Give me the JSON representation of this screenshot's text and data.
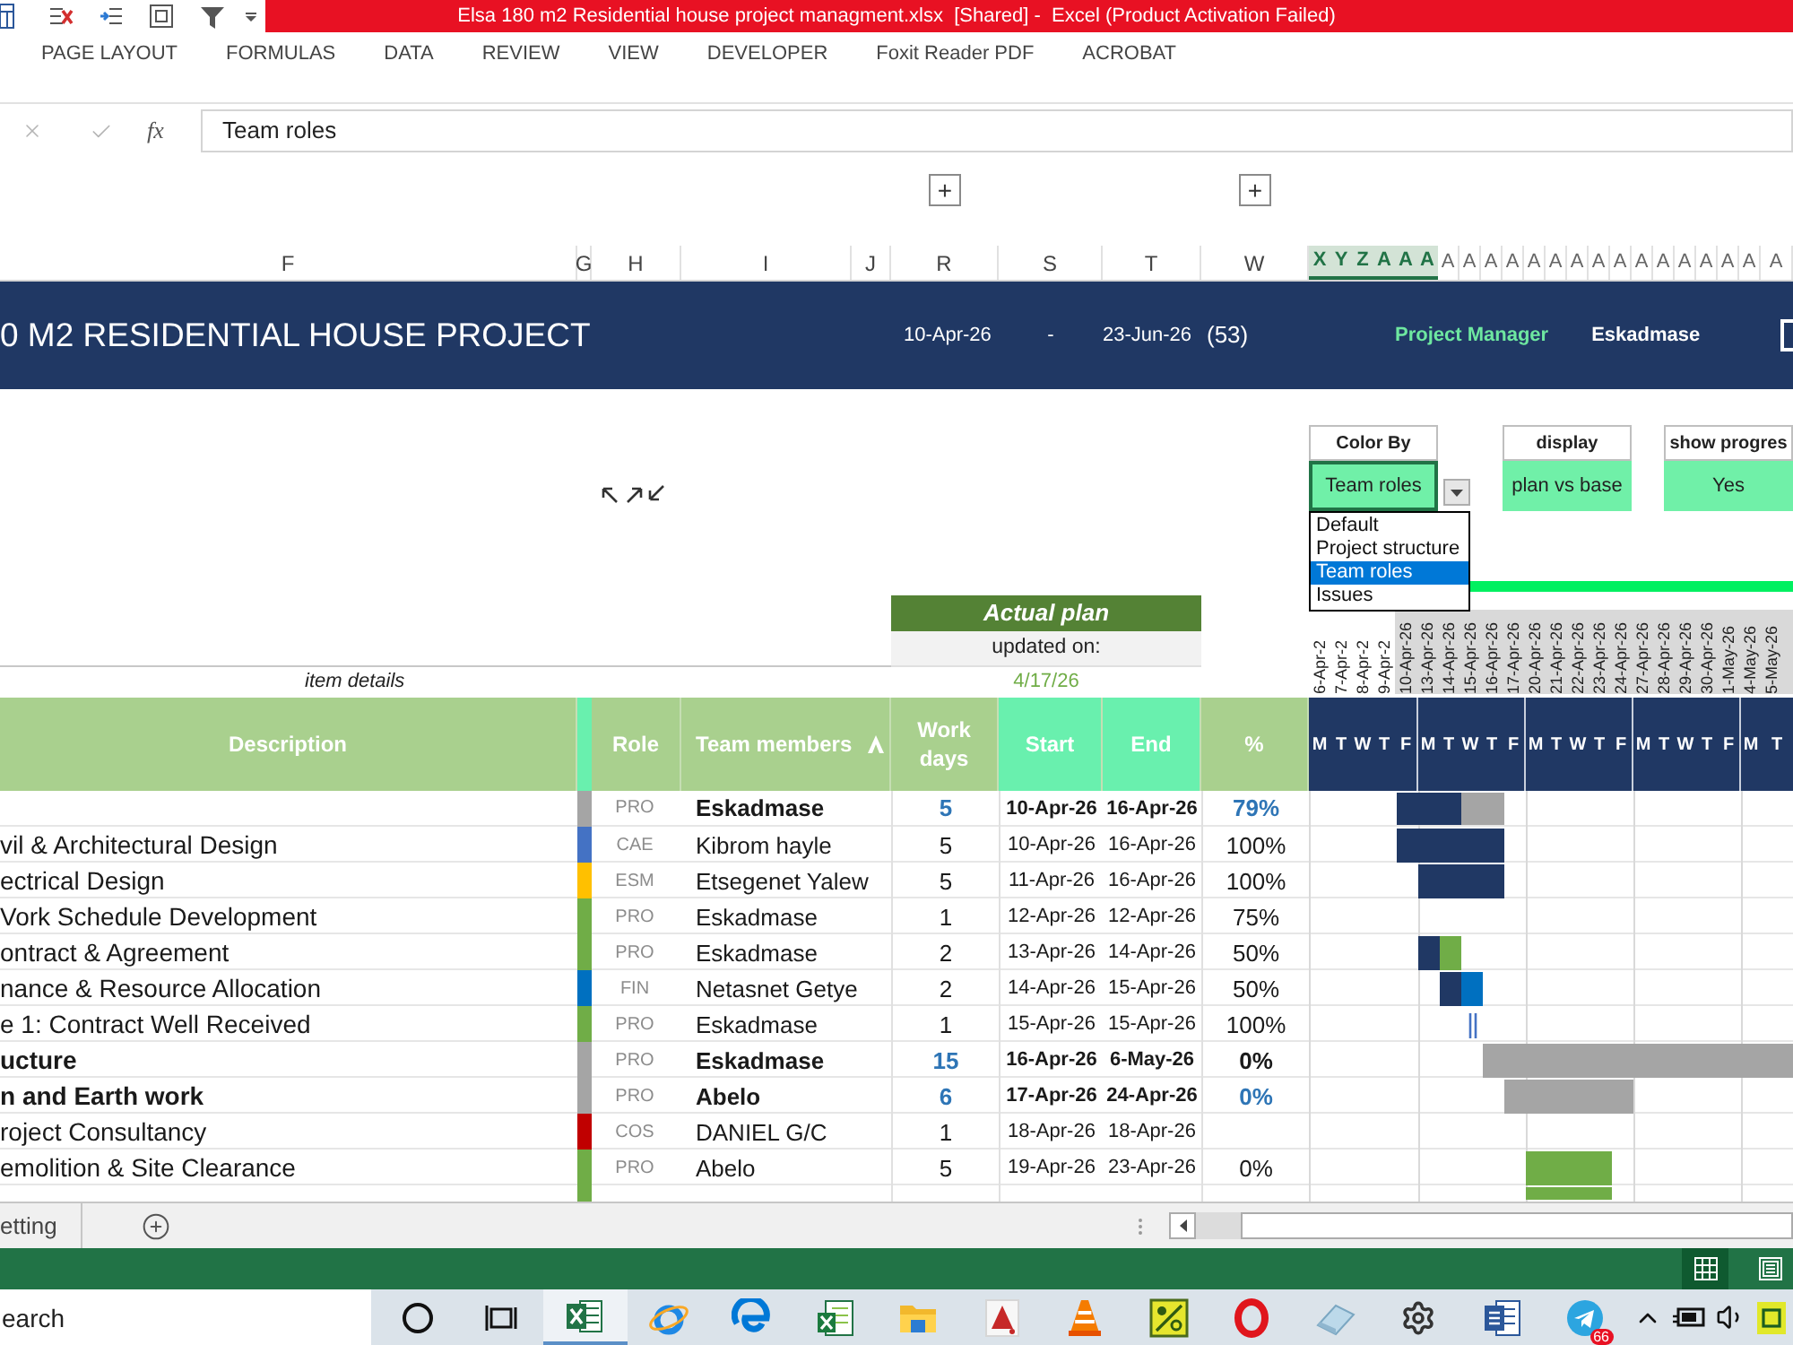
{
  "window": {
    "title": "Elsa 180 m2 Residential house project managment.xlsx  [Shared] -  Excel (Product Activation Failed)"
  },
  "ribbon_tabs": [
    "PAGE LAYOUT",
    "FORMULAS",
    "DATA",
    "REVIEW",
    "VIEW",
    "DEVELOPER",
    "Foxit Reader PDF",
    "ACROBAT"
  ],
  "formula_bar": {
    "function_label": "fx",
    "value": "Team roles"
  },
  "column_headers": [
    {
      "label": "F",
      "selected": false
    },
    {
      "label": "G",
      "selected": false
    },
    {
      "label": "H",
      "selected": false
    },
    {
      "label": "I",
      "selected": false
    },
    {
      "label": "J",
      "selected": false
    },
    {
      "label": "R",
      "selected": false,
      "outline_button": "+"
    },
    {
      "label": "S",
      "selected": false
    },
    {
      "label": "T",
      "selected": false
    },
    {
      "label": "W",
      "selected": false,
      "outline_button": "+"
    }
  ],
  "banner": {
    "title": "0 M2 RESIDENTIAL HOUSE PROJECT",
    "start": "10-Apr-26",
    "separator": "-",
    "end": "23-Jun-26",
    "duration": "(53)",
    "manager_label": "Project Manager",
    "manager": "Eskadmase"
  },
  "settings": [
    {
      "label": "Color By",
      "value": "Team roles",
      "active": true,
      "dropdown": true,
      "options": [
        {
          "label": "Default",
          "selected": false
        },
        {
          "label": "Project structure",
          "selected": false
        },
        {
          "label": "Team roles",
          "selected": true
        },
        {
          "label": "Issues",
          "selected": false
        }
      ]
    },
    {
      "label": "display",
      "value": "plan vs base",
      "active": false,
      "dropdown": false
    },
    {
      "label": "show progres",
      "value": "Yes",
      "active": false,
      "dropdown": false
    }
  ],
  "plan_header": {
    "title": "Actual plan",
    "updated_label": "updated on:",
    "updated_date": "4/17/26",
    "item_details": "item details"
  },
  "table": {
    "columns": [
      {
        "label": "Description",
        "kind": "text",
        "sorted": false
      },
      {
        "label": "Role",
        "kind": "role",
        "sorted": false
      },
      {
        "label": "Team members",
        "kind": "member",
        "sorted": true
      },
      {
        "label": "Work days",
        "kind": "number",
        "sorted": false
      },
      {
        "label": "Start",
        "kind": "date",
        "sorted": false
      },
      {
        "label": "End",
        "kind": "date",
        "sorted": false
      },
      {
        "label": "%",
        "kind": "percent",
        "sorted": false
      }
    ],
    "rows": [
      {
        "kind": "summary",
        "role": "PRO",
        "color": "#a5a5a5",
        "member": "Eskadmase",
        "work_days": "5",
        "start": "10-Apr-26",
        "end": "16-Apr-26",
        "percent": "79%",
        "percent_highlight": true,
        "timeline": [
          {
            "kind": "none"
          },
          {
            "kind": "none"
          },
          {
            "kind": "none"
          },
          {
            "kind": "none"
          },
          {
            "kind": "done"
          },
          {
            "kind": "done"
          },
          {
            "kind": "done"
          },
          {
            "kind": "todo"
          },
          {
            "kind": "todo"
          },
          {
            "kind": "none"
          },
          {
            "kind": "none"
          },
          {
            "kind": "none"
          },
          {
            "kind": "none"
          },
          {
            "kind": "none"
          },
          {
            "kind": "none"
          },
          {
            "kind": "none"
          },
          {
            "kind": "none"
          },
          {
            "kind": "none"
          },
          {
            "kind": "none"
          },
          {
            "kind": "none"
          },
          {
            "kind": "none"
          },
          {
            "kind": "none"
          }
        ]
      },
      {
        "kind": "task",
        "description": "vil & Architectural Design",
        "role": "CAE",
        "color": "#4472c4",
        "member": "Kibrom hayle",
        "work_days": "5",
        "start": "10-Apr-26",
        "end": "16-Apr-26",
        "percent": "100%",
        "percent_highlight": false,
        "timeline": [
          {
            "kind": "none"
          },
          {
            "kind": "none"
          },
          {
            "kind": "none"
          },
          {
            "kind": "none"
          },
          {
            "kind": "done"
          },
          {
            "kind": "done"
          },
          {
            "kind": "done"
          },
          {
            "kind": "done"
          },
          {
            "kind": "done"
          },
          {
            "kind": "none"
          },
          {
            "kind": "none"
          },
          {
            "kind": "none"
          },
          {
            "kind": "none"
          },
          {
            "kind": "none"
          },
          {
            "kind": "none"
          },
          {
            "kind": "none"
          },
          {
            "kind": "none"
          },
          {
            "kind": "none"
          },
          {
            "kind": "none"
          },
          {
            "kind": "none"
          },
          {
            "kind": "none"
          },
          {
            "kind": "none"
          }
        ]
      },
      {
        "kind": "task",
        "description": "ectrical Design",
        "role": "ESM",
        "color": "#ffc000",
        "member": "Etsegenet Yalew",
        "work_days": "5",
        "start": "11-Apr-26",
        "end": "16-Apr-26",
        "percent": "100%",
        "percent_highlight": false,
        "timeline": [
          {
            "kind": "none"
          },
          {
            "kind": "none"
          },
          {
            "kind": "none"
          },
          {
            "kind": "none"
          },
          {
            "kind": "none"
          },
          {
            "kind": "done"
          },
          {
            "kind": "done"
          },
          {
            "kind": "done"
          },
          {
            "kind": "done"
          },
          {
            "kind": "none"
          },
          {
            "kind": "none"
          },
          {
            "kind": "none"
          },
          {
            "kind": "none"
          },
          {
            "kind": "none"
          },
          {
            "kind": "none"
          },
          {
            "kind": "none"
          },
          {
            "kind": "none"
          },
          {
            "kind": "none"
          },
          {
            "kind": "none"
          },
          {
            "kind": "none"
          },
          {
            "kind": "none"
          },
          {
            "kind": "none"
          }
        ]
      },
      {
        "kind": "task",
        "description": "Vork Schedule Development",
        "role": "PRO",
        "color": "#70ad47",
        "member": "Eskadmase",
        "work_days": "1",
        "start": "12-Apr-26",
        "end": "12-Apr-26",
        "percent": "75%",
        "percent_highlight": false,
        "timeline": [
          {
            "kind": "none"
          },
          {
            "kind": "none"
          },
          {
            "kind": "none"
          },
          {
            "kind": "none"
          },
          {
            "kind": "none"
          },
          {
            "kind": "none"
          },
          {
            "kind": "none"
          },
          {
            "kind": "none"
          },
          {
            "kind": "none"
          },
          {
            "kind": "none"
          },
          {
            "kind": "none"
          },
          {
            "kind": "none"
          },
          {
            "kind": "none"
          },
          {
            "kind": "none"
          },
          {
            "kind": "none"
          },
          {
            "kind": "none"
          },
          {
            "kind": "none"
          },
          {
            "kind": "none"
          },
          {
            "kind": "none"
          },
          {
            "kind": "none"
          },
          {
            "kind": "none"
          },
          {
            "kind": "none"
          }
        ]
      },
      {
        "kind": "task",
        "description": "ontract & Agreement",
        "role": "PRO",
        "color": "#70ad47",
        "member": "Eskadmase",
        "work_days": "2",
        "start": "13-Apr-26",
        "end": "14-Apr-26",
        "percent": "50%",
        "percent_highlight": false,
        "timeline": [
          {
            "kind": "none"
          },
          {
            "kind": "none"
          },
          {
            "kind": "none"
          },
          {
            "kind": "none"
          },
          {
            "kind": "none"
          },
          {
            "kind": "done"
          },
          {
            "kind": "todo"
          },
          {
            "kind": "none"
          },
          {
            "kind": "none"
          },
          {
            "kind": "none"
          },
          {
            "kind": "none"
          },
          {
            "kind": "none"
          },
          {
            "kind": "none"
          },
          {
            "kind": "none"
          },
          {
            "kind": "none"
          },
          {
            "kind": "none"
          },
          {
            "kind": "none"
          },
          {
            "kind": "none"
          },
          {
            "kind": "none"
          },
          {
            "kind": "none"
          },
          {
            "kind": "none"
          },
          {
            "kind": "none"
          }
        ]
      },
      {
        "kind": "task",
        "description": "nance & Resource Allocation",
        "role": "FIN",
        "color": "#0070c0",
        "member": "Netasnet Getye",
        "work_days": "2",
        "start": "14-Apr-26",
        "end": "15-Apr-26",
        "percent": "50%",
        "percent_highlight": false,
        "timeline": [
          {
            "kind": "none"
          },
          {
            "kind": "none"
          },
          {
            "kind": "none"
          },
          {
            "kind": "none"
          },
          {
            "kind": "none"
          },
          {
            "kind": "none"
          },
          {
            "kind": "done"
          },
          {
            "kind": "todo"
          },
          {
            "kind": "none"
          },
          {
            "kind": "none"
          },
          {
            "kind": "none"
          },
          {
            "kind": "none"
          },
          {
            "kind": "none"
          },
          {
            "kind": "none"
          },
          {
            "kind": "none"
          },
          {
            "kind": "none"
          },
          {
            "kind": "none"
          },
          {
            "kind": "none"
          },
          {
            "kind": "none"
          },
          {
            "kind": "none"
          },
          {
            "kind": "none"
          },
          {
            "kind": "none"
          }
        ]
      },
      {
        "kind": "task",
        "description": "e 1: Contract Well Received",
        "role": "PRO",
        "color": "#70ad47",
        "member": "Eskadmase",
        "work_days": "1",
        "start": "15-Apr-26",
        "end": "15-Apr-26",
        "percent": "100%",
        "percent_highlight": false,
        "timeline": [
          {
            "kind": "none"
          },
          {
            "kind": "none"
          },
          {
            "kind": "none"
          },
          {
            "kind": "none"
          },
          {
            "kind": "none"
          },
          {
            "kind": "none"
          },
          {
            "kind": "none"
          },
          {
            "kind": "milestone"
          },
          {
            "kind": "none"
          },
          {
            "kind": "none"
          },
          {
            "kind": "none"
          },
          {
            "kind": "none"
          },
          {
            "kind": "none"
          },
          {
            "kind": "none"
          },
          {
            "kind": "none"
          },
          {
            "kind": "none"
          },
          {
            "kind": "none"
          },
          {
            "kind": "none"
          },
          {
            "kind": "none"
          },
          {
            "kind": "none"
          },
          {
            "kind": "none"
          },
          {
            "kind": "none"
          }
        ]
      },
      {
        "kind": "summary",
        "description": "ucture",
        "role": "PRO",
        "color": "#a5a5a5",
        "member": "Eskadmase",
        "work_days": "15",
        "start": "16-Apr-26",
        "end": "6-May-26",
        "percent": "0%",
        "percent_highlight": false,
        "timeline": [
          {
            "kind": "none"
          },
          {
            "kind": "none"
          },
          {
            "kind": "none"
          },
          {
            "kind": "none"
          },
          {
            "kind": "none"
          },
          {
            "kind": "none"
          },
          {
            "kind": "none"
          },
          {
            "kind": "none"
          },
          {
            "kind": "todo"
          },
          {
            "kind": "todo"
          },
          {
            "kind": "todo"
          },
          {
            "kind": "todo"
          },
          {
            "kind": "todo"
          },
          {
            "kind": "todo"
          },
          {
            "kind": "todo"
          },
          {
            "kind": "todo"
          },
          {
            "kind": "todo"
          },
          {
            "kind": "todo"
          },
          {
            "kind": "todo"
          },
          {
            "kind": "todo"
          },
          {
            "kind": "todo"
          },
          {
            "kind": "todo"
          }
        ]
      },
      {
        "kind": "summary",
        "description": "n and Earth work",
        "role": "PRO",
        "color": "#a5a5a5",
        "member": "Abelo",
        "work_days": "6",
        "start": "17-Apr-26",
        "end": "24-Apr-26",
        "percent": "0%",
        "percent_highlight": true,
        "timeline": [
          {
            "kind": "none"
          },
          {
            "kind": "none"
          },
          {
            "kind": "none"
          },
          {
            "kind": "none"
          },
          {
            "kind": "none"
          },
          {
            "kind": "none"
          },
          {
            "kind": "none"
          },
          {
            "kind": "none"
          },
          {
            "kind": "none"
          },
          {
            "kind": "todo"
          },
          {
            "kind": "todo"
          },
          {
            "kind": "todo"
          },
          {
            "kind": "todo"
          },
          {
            "kind": "todo"
          },
          {
            "kind": "todo"
          },
          {
            "kind": "none"
          },
          {
            "kind": "none"
          },
          {
            "kind": "none"
          },
          {
            "kind": "none"
          },
          {
            "kind": "none"
          },
          {
            "kind": "none"
          },
          {
            "kind": "none"
          }
        ]
      },
      {
        "kind": "task",
        "description": "roject Consultancy",
        "role": "COS",
        "color": "#c00000",
        "member": "DANIEL G/C",
        "work_days": "1",
        "start": "18-Apr-26",
        "end": "18-Apr-26",
        "timeline": [
          {
            "kind": "none"
          },
          {
            "kind": "none"
          },
          {
            "kind": "none"
          },
          {
            "kind": "none"
          },
          {
            "kind": "none"
          },
          {
            "kind": "none"
          },
          {
            "kind": "none"
          },
          {
            "kind": "none"
          },
          {
            "kind": "none"
          },
          {
            "kind": "none"
          },
          {
            "kind": "none"
          },
          {
            "kind": "none"
          },
          {
            "kind": "none"
          },
          {
            "kind": "none"
          },
          {
            "kind": "none"
          },
          {
            "kind": "none"
          },
          {
            "kind": "none"
          },
          {
            "kind": "none"
          },
          {
            "kind": "none"
          },
          {
            "kind": "none"
          },
          {
            "kind": "none"
          },
          {
            "kind": "none"
          }
        ]
      },
      {
        "kind": "task",
        "description": "emolition & Site Clearance",
        "role": "PRO",
        "color": "#70ad47",
        "member": "Abelo",
        "work_days": "5",
        "start": "19-Apr-26",
        "end": "23-Apr-26",
        "percent": "0%",
        "percent_highlight": false,
        "timeline": [
          {
            "kind": "none"
          },
          {
            "kind": "none"
          },
          {
            "kind": "none"
          },
          {
            "kind": "none"
          },
          {
            "kind": "none"
          },
          {
            "kind": "none"
          },
          {
            "kind": "none"
          },
          {
            "kind": "none"
          },
          {
            "kind": "none"
          },
          {
            "kind": "none"
          },
          {
            "kind": "todo"
          },
          {
            "kind": "todo"
          },
          {
            "kind": "todo"
          },
          {
            "kind": "todo"
          },
          {
            "kind": "none"
          },
          {
            "kind": "none"
          },
          {
            "kind": "none"
          },
          {
            "kind": "none"
          },
          {
            "kind": "none"
          },
          {
            "kind": "none"
          },
          {
            "kind": "none"
          },
          {
            "kind": "none"
          }
        ]
      },
      {
        "kind": "task",
        "color": "#70ad47",
        "timeline": [
          {
            "kind": "none"
          },
          {
            "kind": "none"
          },
          {
            "kind": "none"
          },
          {
            "kind": "none"
          },
          {
            "kind": "none"
          },
          {
            "kind": "none"
          },
          {
            "kind": "none"
          },
          {
            "kind": "none"
          },
          {
            "kind": "none"
          },
          {
            "kind": "none"
          },
          {
            "kind": "todo"
          },
          {
            "kind": "todo"
          },
          {
            "kind": "todo"
          },
          {
            "kind": "todo"
          },
          {
            "kind": "none"
          },
          {
            "kind": "none"
          },
          {
            "kind": "none"
          },
          {
            "kind": "none"
          },
          {
            "kind": "none"
          },
          {
            "kind": "none"
          },
          {
            "kind": "none"
          },
          {
            "kind": "none"
          }
        ]
      }
    ]
  },
  "gantt": {
    "column_headers": [
      {
        "label": "X",
        "selected": true
      },
      {
        "label": "Y",
        "selected": true
      },
      {
        "label": "Z",
        "selected": true
      },
      {
        "label": "A",
        "selected": true
      },
      {
        "label": "A",
        "selected": true
      },
      {
        "label": "A",
        "selected": true
      },
      {
        "label": "A",
        "selected": false
      },
      {
        "label": "A",
        "selected": false
      },
      {
        "label": "A",
        "selected": false
      },
      {
        "label": "A",
        "selected": false
      },
      {
        "label": "A",
        "selected": false
      },
      {
        "label": "A",
        "selected": false
      },
      {
        "label": "A",
        "selected": false
      },
      {
        "label": "A",
        "selected": false
      },
      {
        "label": "A",
        "selected": false
      },
      {
        "label": "A",
        "selected": false
      },
      {
        "label": "A",
        "selected": false
      },
      {
        "label": "A",
        "selected": false
      },
      {
        "label": "A",
        "selected": false
      },
      {
        "label": "A",
        "selected": false
      },
      {
        "label": "A",
        "selected": false
      },
      {
        "label": "A",
        "selected": false
      }
    ],
    "dates": [
      {
        "label": "6-Apr-2",
        "shaded": false
      },
      {
        "label": "7-Apr-2",
        "shaded": false
      },
      {
        "label": "8-Apr-2",
        "shaded": false
      },
      {
        "label": "9-Apr-2",
        "shaded": false
      },
      {
        "label": "10-Apr-26",
        "shaded": true
      },
      {
        "label": "13-Apr-26",
        "shaded": true
      },
      {
        "label": "14-Apr-26",
        "shaded": true
      },
      {
        "label": "15-Apr-26",
        "shaded": true
      },
      {
        "label": "16-Apr-26",
        "shaded": true
      },
      {
        "label": "17-Apr-26",
        "shaded": true
      },
      {
        "label": "20-Apr-26",
        "shaded": true
      },
      {
        "label": "21-Apr-26",
        "shaded": true
      },
      {
        "label": "22-Apr-26",
        "shaded": true
      },
      {
        "label": "23-Apr-26",
        "shaded": true
      },
      {
        "label": "24-Apr-26",
        "shaded": true
      },
      {
        "label": "27-Apr-26",
        "shaded": true
      },
      {
        "label": "28-Apr-26",
        "shaded": true
      },
      {
        "label": "29-Apr-26",
        "shaded": true
      },
      {
        "label": "30-Apr-26",
        "shaded": true
      },
      {
        "label": "1-May-26",
        "shaded": true
      },
      {
        "label": "4-May-26",
        "shaded": true
      },
      {
        "label": "5-May-26",
        "shaded": true
      }
    ],
    "weekdays": [
      "M",
      "T",
      "W",
      "T",
      "F",
      "M",
      "T",
      "W",
      "T",
      "F",
      "M",
      "T",
      "W",
      "T",
      "F",
      "M",
      "T",
      "W",
      "T",
      "F",
      "M",
      "T"
    ]
  },
  "sheet_tabs": [
    {
      "label": "etting",
      "selected": false
    }
  ],
  "status_bar": {
    "view_buttons": [
      {
        "kind": "normal",
        "selected": true
      },
      {
        "kind": "page_layout",
        "selected": false
      }
    ]
  },
  "taskbar": {
    "search_placeholder": "earch",
    "apps": [
      {
        "kind": "cortana",
        "active": false
      },
      {
        "kind": "task_view",
        "active": false
      },
      {
        "kind": "excel",
        "active": true
      },
      {
        "kind": "ie",
        "active": false
      },
      {
        "kind": "edge",
        "active": false
      },
      {
        "kind": "excel_file",
        "active": false
      },
      {
        "kind": "folder",
        "active": false
      },
      {
        "kind": "pdf",
        "active": false
      },
      {
        "kind": "cone",
        "active": false
      },
      {
        "kind": "tile",
        "active": false
      },
      {
        "kind": "opera",
        "active": false
      },
      {
        "kind": "eraser",
        "active": false
      },
      {
        "kind": "settings",
        "active": false
      },
      {
        "kind": "word",
        "active": false
      },
      {
        "kind": "telegram",
        "active": false,
        "badge": "66"
      }
    ],
    "tray": [
      {
        "kind": "chevron"
      },
      {
        "kind": "battery"
      },
      {
        "kind": "volume"
      },
      {
        "kind": "app"
      }
    ]
  }
}
